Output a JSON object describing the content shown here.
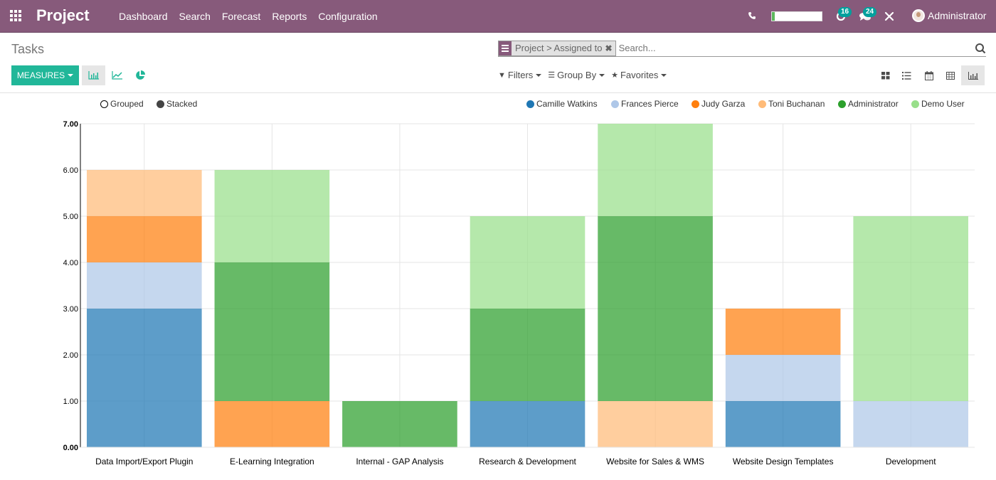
{
  "topbar": {
    "app_name": "Project",
    "menu": [
      "Dashboard",
      "Search",
      "Forecast",
      "Reports",
      "Configuration"
    ],
    "progress_fraction": 0.05,
    "activity_count": "16",
    "messages_count": "24",
    "user_name": "Administrator",
    "brand_color": "#875a7b"
  },
  "control_panel": {
    "title": "Tasks",
    "measures_label": "MEASURES",
    "chart_types": [
      "bar-chart-icon",
      "line-chart-icon",
      "pie-chart-icon"
    ],
    "active_chart_type": "bar",
    "search": {
      "facet_label": "Project > Assigned to",
      "placeholder": "Search..."
    },
    "filters_label": "Filters",
    "group_by_label": "Group By",
    "favorites_label": "Favorites",
    "views": [
      "kanban",
      "list",
      "calendar",
      "pivot",
      "graph"
    ],
    "active_view": "graph",
    "accent_color": "#21b799"
  },
  "chart_modes": {
    "grouped_label": "Grouped",
    "stacked_label": "Stacked",
    "active": "stacked"
  },
  "chart_data": {
    "type": "bar",
    "stacked": true,
    "title": "",
    "xlabel": "",
    "ylabel": "",
    "ylim": [
      0,
      7
    ],
    "yticks": [
      "0.00",
      "1.00",
      "2.00",
      "3.00",
      "4.00",
      "5.00",
      "6.00",
      "7.00"
    ],
    "grid": true,
    "legend_position": "top-right",
    "categories": [
      "Data Import/Export Plugin",
      "E-Learning Integration",
      "Internal - GAP Analysis",
      "Research & Development",
      "Website for Sales & WMS",
      "Website Design Templates",
      "Development"
    ],
    "series": [
      {
        "name": "Camille Watkins",
        "color": "#1f77b4",
        "values": [
          3,
          0,
          0,
          1,
          0,
          1,
          0
        ]
      },
      {
        "name": "Frances Pierce",
        "color": "#aec7e8",
        "values": [
          1,
          0,
          0,
          0,
          0,
          1,
          1
        ]
      },
      {
        "name": "Judy Garza",
        "color": "#ff7f0e",
        "values": [
          1,
          1,
          0,
          0,
          0,
          1,
          0
        ]
      },
      {
        "name": "Toni Buchanan",
        "color": "#ffbb78",
        "values": [
          1,
          0,
          0,
          0,
          1,
          0,
          0
        ]
      },
      {
        "name": "Administrator",
        "color": "#2ca02c",
        "values": [
          0,
          3,
          1,
          2,
          4,
          0,
          0
        ]
      },
      {
        "name": "Demo User",
        "color": "#98df8a",
        "values": [
          0,
          2,
          0,
          2,
          2,
          0,
          4
        ]
      }
    ]
  }
}
